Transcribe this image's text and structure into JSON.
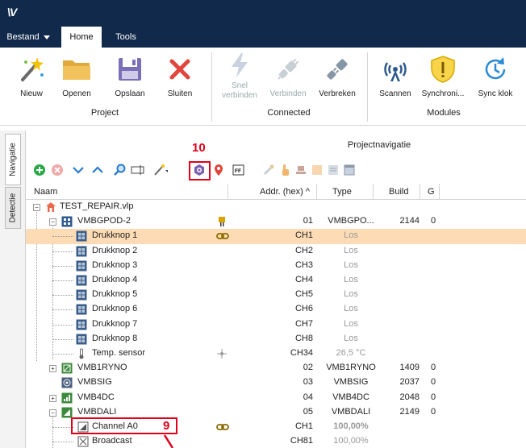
{
  "app": {
    "logo": "\\V"
  },
  "menu": {
    "bestand": "Bestand",
    "home": "Home",
    "tools": "Tools"
  },
  "ribbon": {
    "buttons": [
      {
        "label": "Nieuw",
        "icon": "magic-wand-icon"
      },
      {
        "label": "Openen",
        "icon": "folder-icon"
      },
      {
        "label": "Opslaan",
        "icon": "floppy-disk-icon"
      },
      {
        "label": "Sluiten",
        "icon": "close-x-icon"
      },
      {
        "label_line1": "Snel",
        "label_line2": "verbinden",
        "icon": "lightning-icon",
        "disabled": true
      },
      {
        "label": "Verbinden",
        "icon": "plug-connect-icon",
        "disabled": true
      },
      {
        "label": "Verbreken",
        "icon": "plug-disconnect-icon"
      },
      {
        "label": "Scannen",
        "icon": "antenna-icon"
      },
      {
        "label": "Synchroni...",
        "icon": "shield-warning-icon"
      },
      {
        "label": "Sync klok",
        "icon": "clock-sync-icon"
      }
    ],
    "groups": {
      "project": "Project",
      "connected": "Connected",
      "modules": "Modules"
    }
  },
  "sidetabs": {
    "navigatie": "Navigatie",
    "detectie": "Detectie"
  },
  "panel": {
    "title": "Projectnavigatie"
  },
  "callouts": {
    "ten": "10",
    "nine": "9"
  },
  "grid": {
    "headers": {
      "naam": "Naam",
      "addr": "Addr. (hex) ^",
      "type": "Type",
      "build": "Build",
      "g": "G"
    },
    "rows": [
      {
        "name": "TEST_REPAIR.vlp",
        "addr": "",
        "type": "",
        "build": "",
        "g": ""
      },
      {
        "name": "VMBGPOD-2",
        "addr": "01",
        "type": "VMBGPO...",
        "build": "2144",
        "g": "0"
      },
      {
        "name": "Drukknop 1",
        "addr": "CH1",
        "type": "Los",
        "build": "",
        "g": ""
      },
      {
        "name": "Drukknop 2",
        "addr": "CH2",
        "type": "Los",
        "build": "",
        "g": ""
      },
      {
        "name": "Drukknop 3",
        "addr": "CH3",
        "type": "Los",
        "build": "",
        "g": ""
      },
      {
        "name": "Drukknop 4",
        "addr": "CH4",
        "type": "Los",
        "build": "",
        "g": ""
      },
      {
        "name": "Drukknop 5",
        "addr": "CH5",
        "type": "Los",
        "build": "",
        "g": ""
      },
      {
        "name": "Drukknop 6",
        "addr": "CH6",
        "type": "Los",
        "build": "",
        "g": ""
      },
      {
        "name": "Drukknop 7",
        "addr": "CH7",
        "type": "Los",
        "build": "",
        "g": ""
      },
      {
        "name": "Drukknop 8",
        "addr": "CH8",
        "type": "Los",
        "build": "",
        "g": ""
      },
      {
        "name": "Temp. sensor",
        "addr": "CH34",
        "type": "26,5 °C",
        "build": "",
        "g": ""
      },
      {
        "name": "VMB1RYNO",
        "addr": "02",
        "type": "VMB1RYNO",
        "build": "1409",
        "g": "0"
      },
      {
        "name": "VMBSIG",
        "addr": "03",
        "type": "VMBSIG",
        "build": "2037",
        "g": "0"
      },
      {
        "name": "VMB4DC",
        "addr": "04",
        "type": "VMB4DC",
        "build": "2048",
        "g": "0"
      },
      {
        "name": "VMBDALI",
        "addr": "05",
        "type": "VMBDALI",
        "build": "2149",
        "g": "0"
      },
      {
        "name": "Channel A0",
        "addr": "CH1",
        "type": "100,00%",
        "build": "",
        "g": ""
      },
      {
        "name": "Broadcast",
        "addr": "CH81",
        "type": "100,00%",
        "build": "",
        "g": ""
      }
    ]
  },
  "colors": {
    "titlebar": "#11294a",
    "selected_row": "#fddcb5",
    "callout": "#e1001a"
  }
}
